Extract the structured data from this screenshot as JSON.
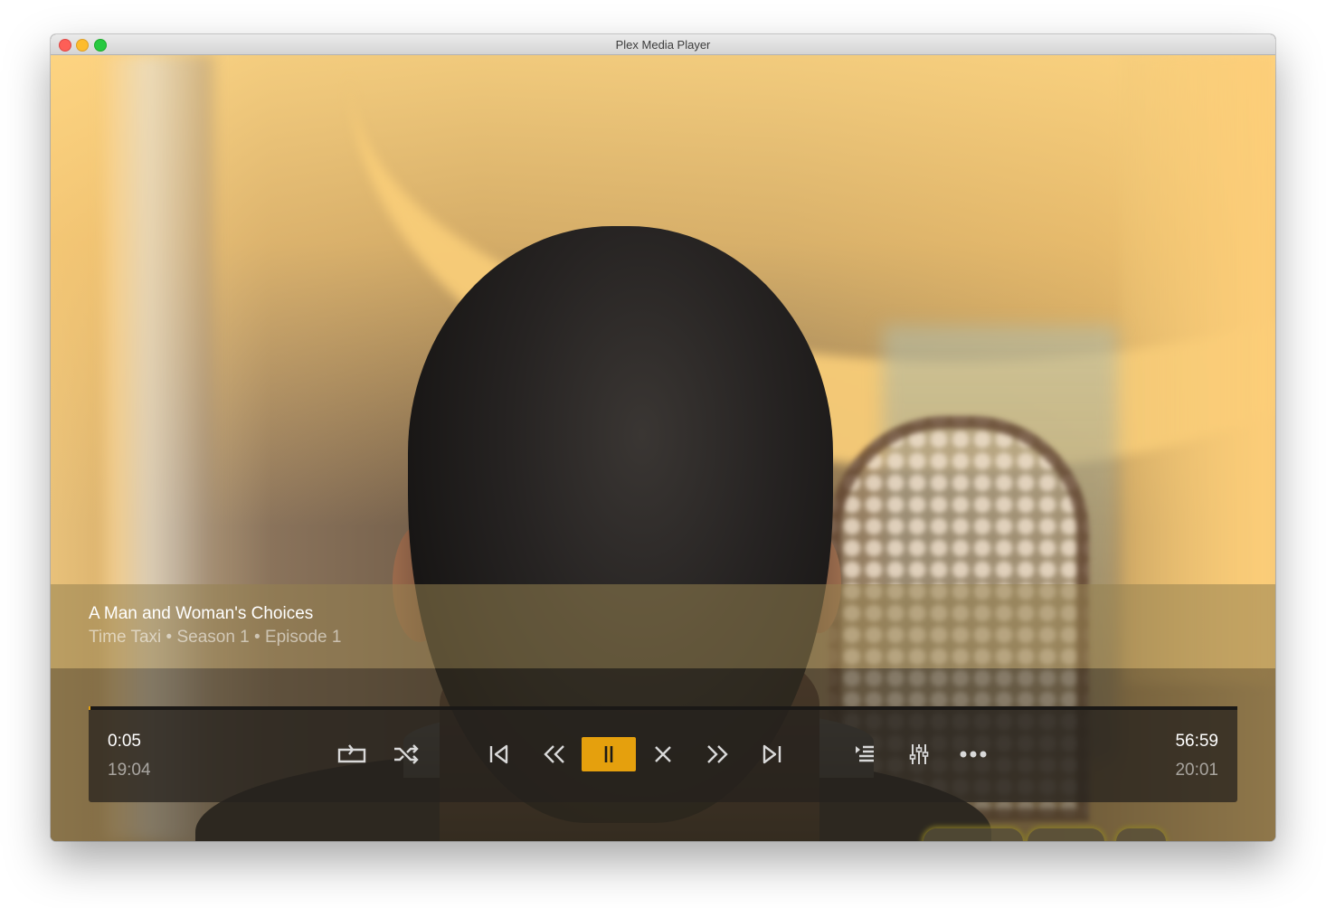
{
  "window": {
    "title": "Plex Media Player"
  },
  "media": {
    "title": "A Man and Woman's Choices",
    "subtitle": "Time Taxi • Season 1 • Episode 1"
  },
  "playback": {
    "elapsed": "0:05",
    "current_clock": "19:04",
    "duration": "56:59",
    "end_clock": "20:01",
    "progress_fraction": 0.0015,
    "state": "playing"
  },
  "controls": [
    {
      "name": "repeat-button",
      "icon": "repeat-icon"
    },
    {
      "name": "shuffle-button",
      "icon": "shuffle-icon"
    },
    {
      "name": "previous-button",
      "icon": "skip-previous-icon"
    },
    {
      "name": "rewind-button",
      "icon": "rewind-icon"
    },
    {
      "name": "pause-button",
      "icon": "pause-icon",
      "active": true
    },
    {
      "name": "stop-button",
      "icon": "close-icon"
    },
    {
      "name": "fast-forward-button",
      "icon": "fast-forward-icon"
    },
    {
      "name": "next-button",
      "icon": "skip-next-icon"
    },
    {
      "name": "playlist-button",
      "icon": "playlist-icon"
    },
    {
      "name": "audio-settings-button",
      "icon": "sliders-icon"
    },
    {
      "name": "more-button",
      "icon": "more-horizontal-icon"
    }
  ],
  "colors": {
    "accent": "#e5a00d",
    "icon": "#d9d9d9"
  }
}
